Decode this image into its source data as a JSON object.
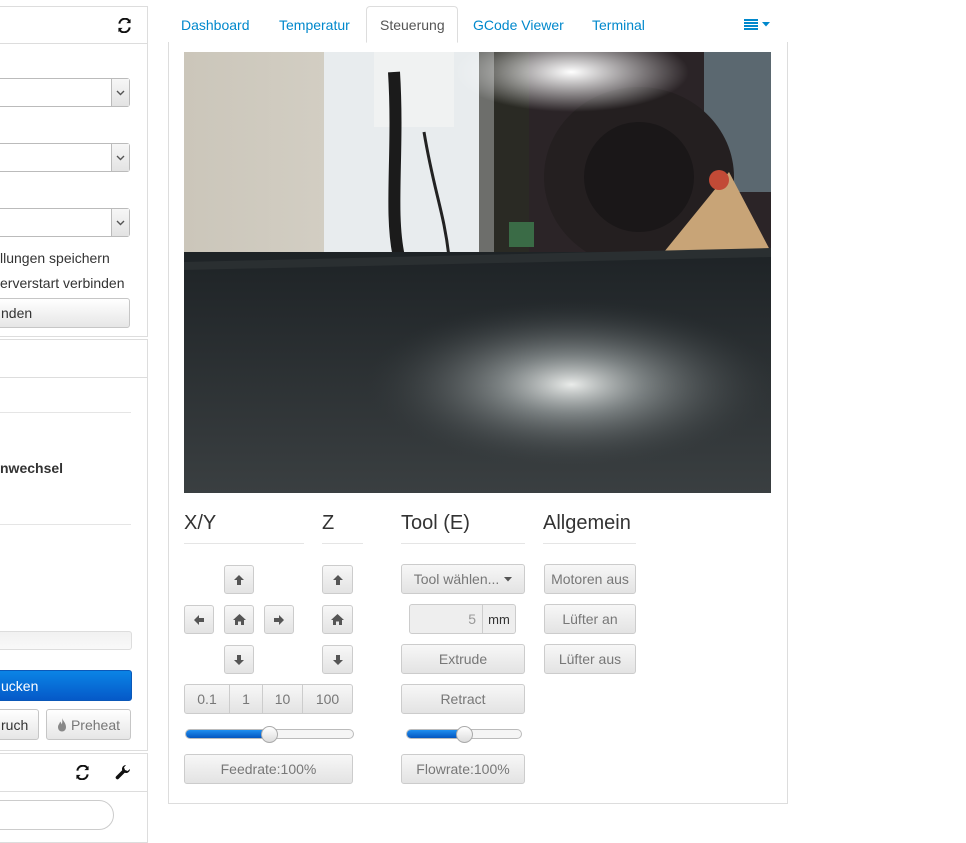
{
  "sidebar": {
    "connection": {
      "connection_options": [
        "",
        "",
        ""
      ],
      "save_settings_label": "llungen speichern",
      "autoconnect_label": "erverstart verbinden",
      "connect_button": "nden"
    },
    "state": {
      "filament_change_label": "nwechsel"
    },
    "print_button": "ucken",
    "pause_button": "ruch",
    "preheat_button": "Preheat",
    "files_search_placeholder": ""
  },
  "tabs": [
    "Dashboard",
    "Temperatur",
    "Steuerung",
    "GCode Viewer",
    "Terminal"
  ],
  "active_tab": "Steuerung",
  "controls": {
    "xy": {
      "title": "X/Y",
      "step_options": [
        "0.1",
        "1",
        "10",
        "100"
      ],
      "feedrate_label": "Feedrate:100%",
      "feedrate_percent": 100
    },
    "z": {
      "title": "Z"
    },
    "tool": {
      "title": "Tool (E)",
      "tool_select_label": "Tool wählen...",
      "extrude_amount": "5",
      "extrude_unit": "mm",
      "extrude_button": "Extrude",
      "retract_button": "Retract",
      "flowrate_label": "Flowrate:100%",
      "flowrate_percent": 100
    },
    "general": {
      "title": "Allgemein",
      "motors_off": "Motoren aus",
      "fan_on": "Lüfter an",
      "fan_off": "Lüfter aus"
    }
  }
}
